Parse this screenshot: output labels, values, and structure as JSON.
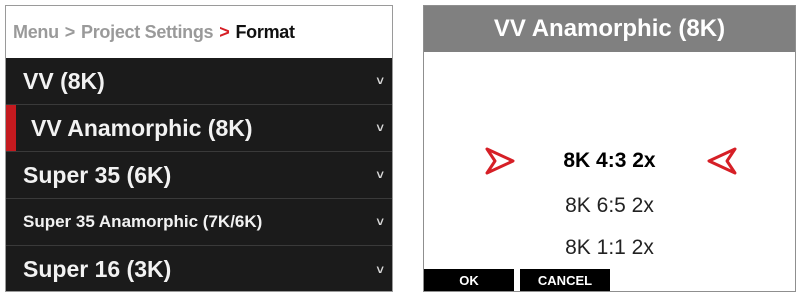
{
  "breadcrumb": {
    "item1": "Menu",
    "sep1": ">",
    "item2": "Project Settings",
    "sep2": ">",
    "current": "Format"
  },
  "menu": {
    "items": [
      {
        "label": "VV (8K)",
        "chevron": "˅"
      },
      {
        "label": "VV Anamorphic (8K)",
        "chevron": "˅"
      },
      {
        "label": "Super 35 (6K)",
        "chevron": "˅"
      },
      {
        "label": "Super 35 Anamorphic (7K/6K)",
        "chevron": "˅"
      },
      {
        "label": "Super 16 (3K)",
        "chevron": "˅"
      }
    ],
    "selected_index": 1
  },
  "dialog": {
    "title": "VV Anamorphic (8K)",
    "options": [
      "8K 4:3 2x",
      "8K 6:5 2x",
      "8K 1:1 2x"
    ],
    "selected_index": 0,
    "ok_label": "OK",
    "cancel_label": "CANCEL"
  },
  "colors": {
    "accent_red": "#d61f26",
    "menu_bg": "#1b1b1b",
    "title_bar": "#808080"
  },
  "icons": {
    "chevron": "chevron-down-icon",
    "left_arrow": "arrow-right-outline-icon",
    "right_arrow": "arrow-left-outline-icon"
  }
}
